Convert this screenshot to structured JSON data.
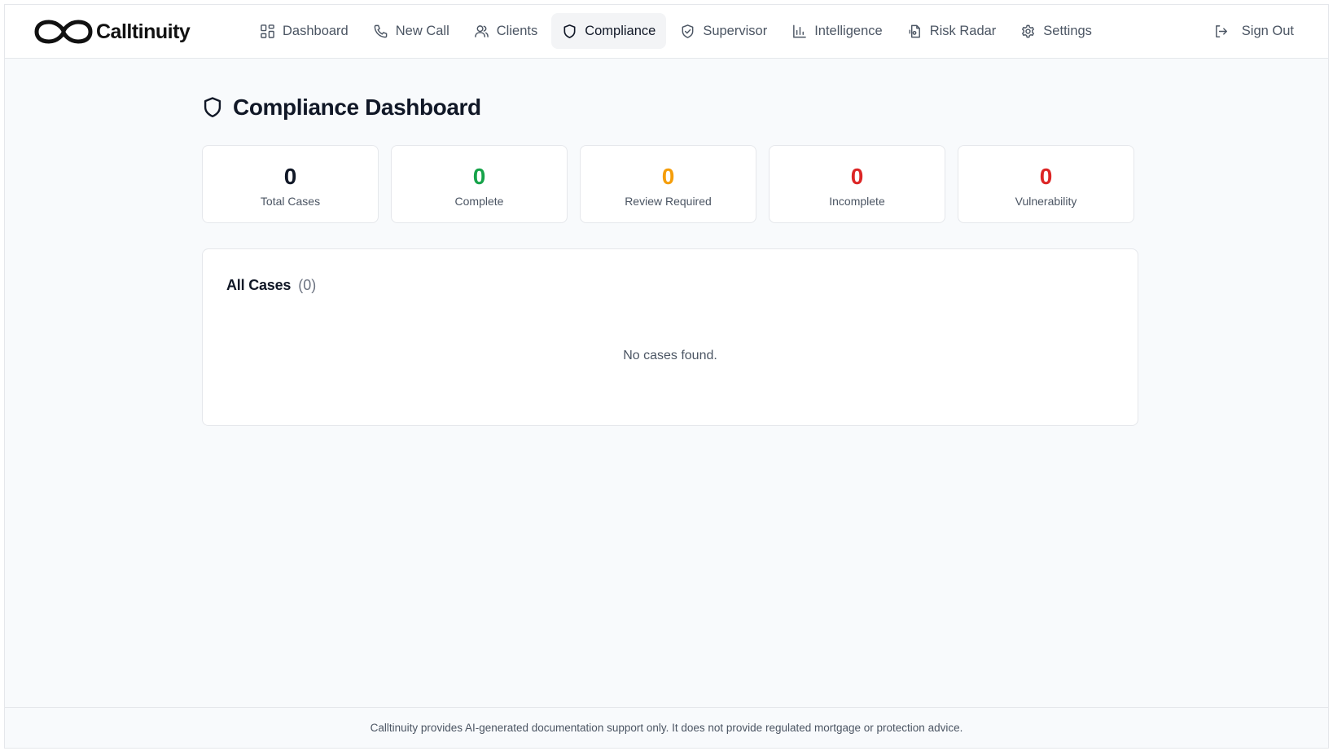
{
  "brand": {
    "name": "Calltinuity",
    "logo_icon": "infinity-logo"
  },
  "nav": {
    "items": [
      {
        "label": "Dashboard",
        "icon": "grid-icon",
        "active": false
      },
      {
        "label": "New Call",
        "icon": "phone-icon",
        "active": false
      },
      {
        "label": "Clients",
        "icon": "users-icon",
        "active": false
      },
      {
        "label": "Compliance",
        "icon": "shield-icon",
        "active": true
      },
      {
        "label": "Supervisor",
        "icon": "shield-check-icon",
        "active": false
      },
      {
        "label": "Intelligence",
        "icon": "bar-chart-icon",
        "active": false
      },
      {
        "label": "Risk Radar",
        "icon": "file-icon",
        "active": false
      },
      {
        "label": "Settings",
        "icon": "gear-icon",
        "active": false
      }
    ],
    "sign_out": {
      "label": "Sign Out",
      "icon": "log-out-icon"
    }
  },
  "page": {
    "title": "Compliance Dashboard",
    "title_icon": "shield-icon"
  },
  "stats": [
    {
      "value": "0",
      "label": "Total Cases",
      "color": "#111827"
    },
    {
      "value": "0",
      "label": "Complete",
      "color": "#16a34a"
    },
    {
      "value": "0",
      "label": "Review Required",
      "color": "#f59e0b"
    },
    {
      "value": "0",
      "label": "Incomplete",
      "color": "#dc2626"
    },
    {
      "value": "0",
      "label": "Vulnerability",
      "color": "#dc2626"
    }
  ],
  "cases": {
    "title": "All Cases",
    "count": "(0)",
    "empty_message": "No cases found."
  },
  "footer": {
    "disclaimer": "Calltinuity provides AI-generated documentation support only. It does not provide regulated mortgage or protection advice."
  }
}
